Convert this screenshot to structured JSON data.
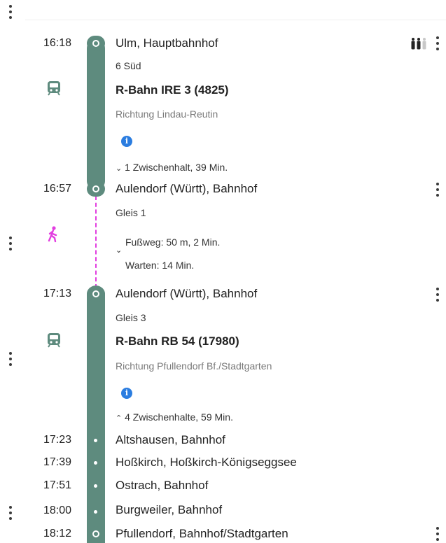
{
  "segments": {
    "first": {
      "dep_time": "16:18",
      "dep_stop": "Ulm, Hauptbahnhof",
      "platform": "6 Süd",
      "train": "R-Bahn IRE 3 (4825)",
      "direction": "Richtung Lindau-Reutin",
      "info": "i",
      "intermediate": "1 Zwischenhalt, 39 Min.",
      "arr_time": "16:57",
      "arr_stop": "Aulendorf (Württ), Bahnhof",
      "arr_platform": "Gleis 1"
    },
    "walk": {
      "distance": "Fußweg: 50 m, 2 Min.",
      "wait": "Warten: 14 Min."
    },
    "second": {
      "dep_time": "17:13",
      "dep_stop": "Aulendorf (Württ), Bahnhof",
      "platform": "Gleis 3",
      "train": "R-Bahn RB 54 (17980)",
      "direction": "Richtung Pfullendorf Bf./Stadtgarten",
      "info": "i",
      "intermediate": "4 Zwischenhalte, 59 Min.",
      "stops": [
        {
          "time": "17:23",
          "name": "Altshausen, Bahnhof"
        },
        {
          "time": "17:39",
          "name": "Hoßkirch, Hoßkirch-Königseggsee"
        },
        {
          "time": "17:51",
          "name": "Ostrach, Bahnhof"
        },
        {
          "time": "18:00",
          "name": "Burgweiler, Bahnhof"
        }
      ],
      "arr_time": "18:12",
      "arr_stop": "Pfullendorf, Bahnhof/Stadtgarten"
    }
  },
  "icons": {
    "train": "train-icon",
    "walk": "walking-person-icon",
    "occupancy": "occupancy-icon",
    "more": "kebab-menu-icon",
    "info": "info-icon",
    "chevron_down": "chevron-down-icon",
    "chevron_up": "chevron-up-icon"
  },
  "colors": {
    "line": "#5e8b7e",
    "walk": "#e23ee0",
    "info": "#2b7de0",
    "occupancy_dark": "#222222",
    "occupancy_light": "#c8c8c8"
  }
}
